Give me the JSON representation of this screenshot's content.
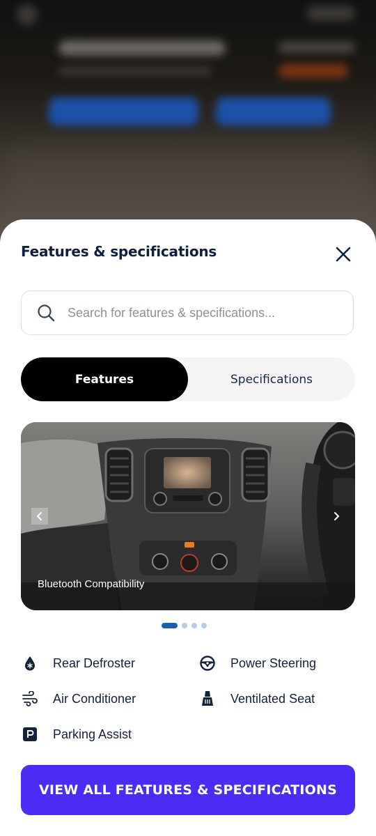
{
  "colors": {
    "cta_background": "#4a2cf5",
    "active_dot": "#1c5fb0",
    "title_text": "#0f1f3c"
  },
  "sheet": {
    "title": "Features & specifications",
    "close_icon": "close-icon"
  },
  "search": {
    "placeholder": "Search for features & specifications...",
    "icon": "search-icon"
  },
  "tabs": [
    {
      "label": "Features",
      "active": true
    },
    {
      "label": "Specifications",
      "active": false
    }
  ],
  "carousel": {
    "caption": "Bluetooth Compatibility",
    "slide_count": 4,
    "active_index": 0,
    "prev_icon": "chevron-left-icon",
    "next_icon": "chevron-right-icon"
  },
  "features": [
    {
      "label": "Rear Defroster",
      "icon": "defroster-icon"
    },
    {
      "label": "Power Steering",
      "icon": "steering-wheel-icon"
    },
    {
      "label": "Air Conditioner",
      "icon": "air-conditioner-icon"
    },
    {
      "label": "Ventilated Seat",
      "icon": "ventilated-seat-icon"
    },
    {
      "label": "Parking Assist",
      "icon": "parking-icon"
    }
  ],
  "cta": {
    "label": "VIEW ALL FEATURES & SPECIFICATIONS"
  }
}
